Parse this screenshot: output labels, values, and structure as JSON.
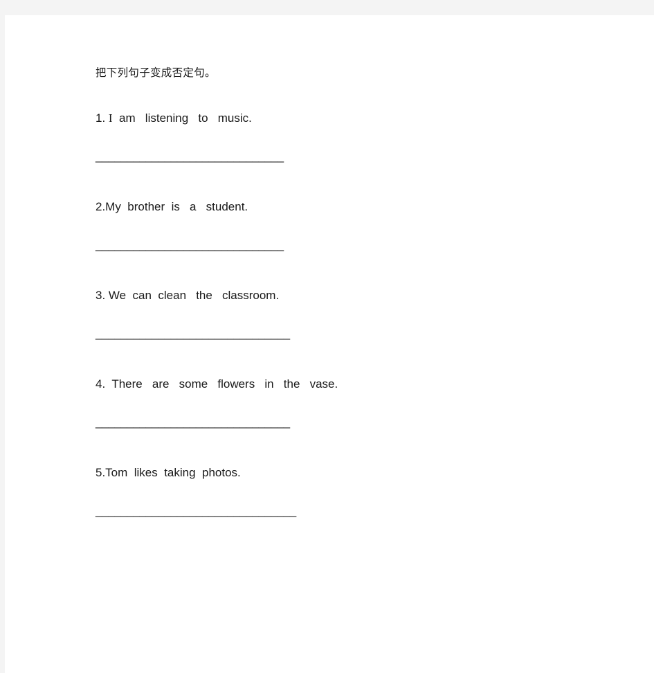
{
  "document": {
    "instruction": "把下列句子变成否定句。",
    "text_color": "#1a1a1a",
    "page_background": "#ffffff",
    "chrome_background": "#f4f4f4",
    "questions": [
      {
        "number": "1.",
        "prefix": "1. ",
        "lead_glyph": "I",
        "text": "  am   listening   to   music.",
        "full_text": "1. I  am   listening   to   music.",
        "answer_line": "______________________________"
      },
      {
        "number": "2.",
        "prefix": "",
        "lead_glyph": "",
        "text": "2.My  brother  is   a   student.",
        "full_text": "2.My  brother  is   a   student.",
        "answer_line": "______________________________"
      },
      {
        "number": "3.",
        "prefix": "",
        "lead_glyph": "",
        "text": "3. We  can  clean   the   classroom.",
        "full_text": "3. We  can  clean   the   classroom.",
        "answer_line": "_______________________________"
      },
      {
        "number": "4.",
        "prefix": "",
        "lead_glyph": "",
        "text": "4.  There   are   some   flowers   in   the   vase.",
        "full_text": "4.  There   are   some   flowers   in   the   vase.",
        "answer_line": "_______________________________"
      },
      {
        "number": "5.",
        "prefix": "",
        "lead_glyph": "",
        "text": "5.Tom  likes  taking  photos.",
        "full_text": "5.Tom  likes  taking  photos.",
        "answer_line": "________________________________"
      }
    ]
  }
}
